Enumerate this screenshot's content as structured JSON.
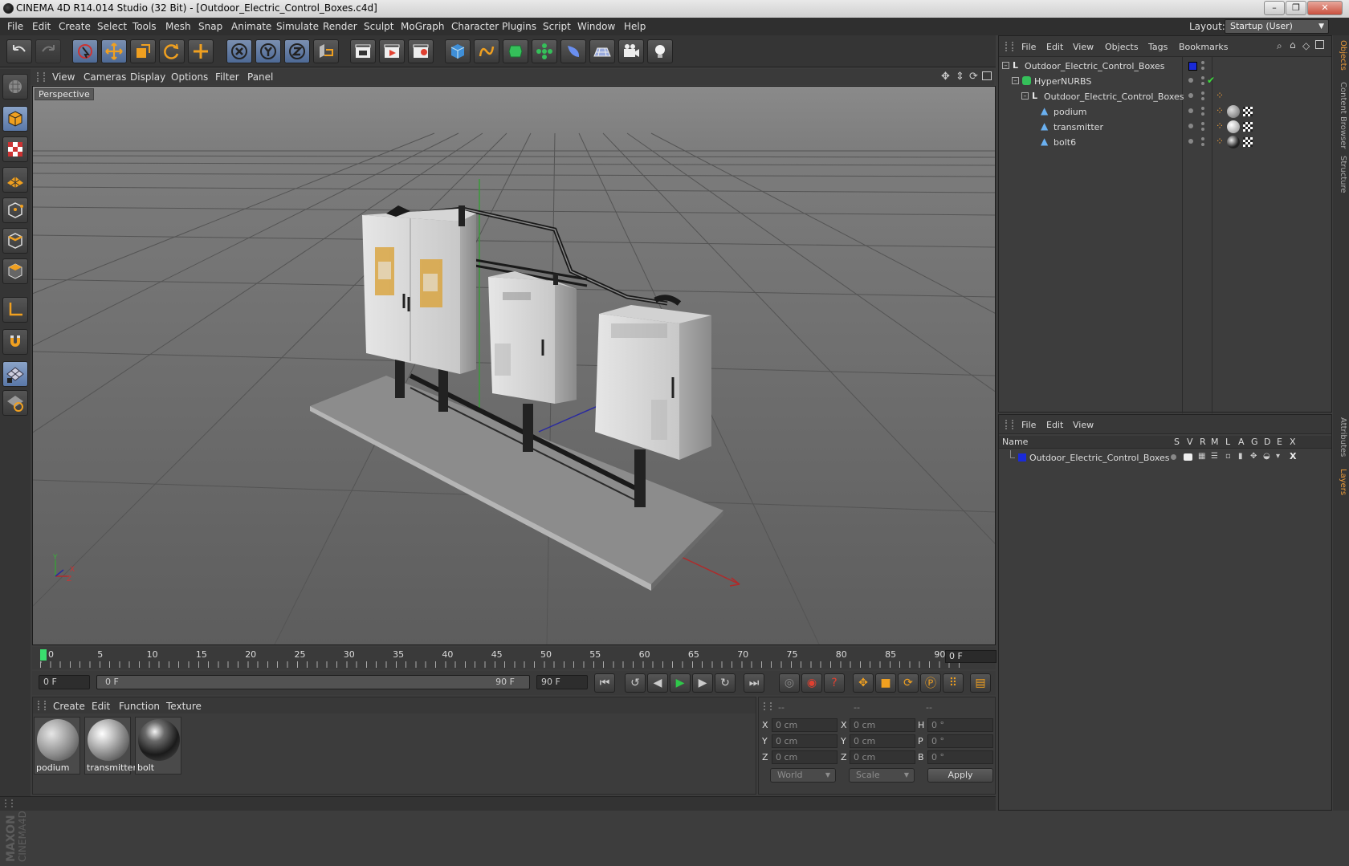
{
  "window": {
    "title": "CINEMA 4D R14.014 Studio (32 Bit) - [Outdoor_Electric_Control_Boxes.c4d]",
    "controls": [
      "–",
      "❐",
      "✕"
    ]
  },
  "menubar": {
    "items": [
      "File",
      "Edit",
      "Create",
      "Select",
      "Tools",
      "Mesh",
      "Snap",
      "Animate",
      "Simulate",
      "Render",
      "Sculpt",
      "MoGraph",
      "Character",
      "Plugins",
      "Script",
      "Window",
      "Help"
    ],
    "layout_label": "Layout:",
    "layout_value": "Startup (User)"
  },
  "toolbar": {
    "buttons": [
      "undo-icon",
      "redo-icon",
      "live-selection-icon",
      "move-icon",
      "scale-icon",
      "rotate-icon",
      "add-icon",
      "x-axis-icon",
      "y-axis-icon",
      "z-axis-icon",
      "world-coordinates-icon",
      "render-view-icon",
      "render-picture-viewer-icon",
      "edit-render-settings-icon",
      "cube-icon",
      "spline-icon",
      "nurbs-icon",
      "array-icon",
      "deformer-icon",
      "scene-floor-icon",
      "camera-icon",
      "light-icon"
    ]
  },
  "left_tools": [
    "make-editable-icon",
    "model-mode-icon",
    "texture-mode-icon",
    "workplane-icon",
    "points-mode-icon",
    "edges-mode-icon",
    "polygons-mode-icon",
    "axis-mode-icon",
    "tweak-mode-icon",
    "snap-icon",
    "lock-workplane-icon"
  ],
  "viewport": {
    "menu": [
      "View",
      "Cameras",
      "Display",
      "Options",
      "Filter",
      "Panel"
    ],
    "label": "Perspective",
    "axis_labels": {
      "y": "Y",
      "x": "X",
      "z": "Z"
    }
  },
  "timeline": {
    "ticks": [
      "0",
      "5",
      "10",
      "15",
      "20",
      "25",
      "30",
      "35",
      "40",
      "45",
      "50",
      "55",
      "60",
      "65",
      "70",
      "75",
      "80",
      "85",
      "90"
    ],
    "current_frame": "0 F"
  },
  "playbar": {
    "start_field": "0 F",
    "range_start": "0 F",
    "range_end": "90 F",
    "end_field": "90 F"
  },
  "materials": {
    "menu": [
      "Create",
      "Edit",
      "Function",
      "Texture"
    ],
    "items": [
      {
        "name": "podium"
      },
      {
        "name": "transmitter"
      },
      {
        "name": "bolt"
      }
    ]
  },
  "coordinates": {
    "headers": [
      "--",
      "--",
      "--"
    ],
    "rows": [
      {
        "a": "X",
        "av": "0 cm",
        "b": "X",
        "bv": "0 cm",
        "c": "H",
        "cv": "0 °"
      },
      {
        "a": "Y",
        "av": "0 cm",
        "b": "Y",
        "bv": "0 cm",
        "c": "P",
        "cv": "0 °"
      },
      {
        "a": "Z",
        "av": "0 cm",
        "b": "Z",
        "bv": "0 cm",
        "c": "B",
        "cv": "0 °"
      }
    ],
    "world": "World",
    "scale": "Scale",
    "apply": "Apply"
  },
  "objects": {
    "menu": [
      "File",
      "Edit",
      "View",
      "Objects",
      "Tags",
      "Bookmarks"
    ],
    "tree": [
      {
        "name": "Outdoor_Electric_Control_Boxes",
        "icon": "null-icon"
      },
      {
        "name": "HyperNURBS",
        "icon": "hypernurbs-icon"
      },
      {
        "name": "Outdoor_Electric_Control_Boxes",
        "icon": "null-icon"
      },
      {
        "name": "podium",
        "icon": "polygon-icon"
      },
      {
        "name": "transmitter",
        "icon": "polygon-icon"
      },
      {
        "name": "bolt6",
        "icon": "polygon-icon"
      }
    ]
  },
  "layers": {
    "menu": [
      "File",
      "Edit",
      "View"
    ],
    "name_header": "Name",
    "columns": [
      "S",
      "V",
      "R",
      "M",
      "L",
      "A",
      "G",
      "D",
      "E",
      "X"
    ],
    "rows": [
      {
        "name": "Outdoor_Electric_Control_Boxes",
        "color": "#1a2ad8"
      }
    ]
  },
  "right_tabs": [
    "Objects",
    "Content Browser",
    "Structure",
    "Attributes",
    "Layers"
  ],
  "brand": {
    "text": "MAXON CINEMA4D"
  },
  "colors": {
    "accent": "#e89a3a",
    "layer_blue": "#1a2ad8",
    "play_green": "#2fc84a",
    "timeline_marker": "#3adf6e"
  }
}
